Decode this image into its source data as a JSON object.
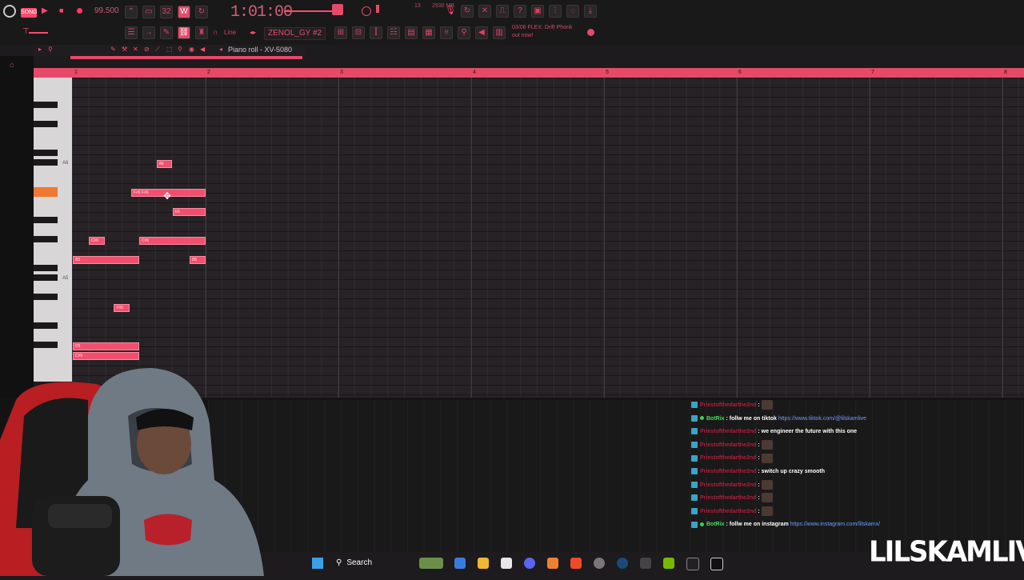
{
  "toolbar": {
    "song_label": "SONG",
    "tempo": "99.500",
    "time": "1:01:00",
    "cpu": "13",
    "memory": "2930 MB",
    "pattern": "ZENOL_GY #2",
    "snap": "Line",
    "hint_line1": "03/06 FLEX: Drift Phonk",
    "hint_line2": "out now!"
  },
  "piano_roll": {
    "title": "Piano roll - XV-5080",
    "bar_numbers": [
      "1",
      "2",
      "3",
      "4",
      "5",
      "6",
      "7",
      "8"
    ],
    "key_labels": [
      "A6",
      "A5"
    ],
    "notes": [
      {
        "label": "A6",
        "pitch": "A6",
        "start_bar": 1.63,
        "length_bars": 0.12
      },
      {
        "label": "F#6 F#6",
        "pitch": "F#6",
        "start_bar": 1.44,
        "length_bars": 0.56
      },
      {
        "label": "E6",
        "pitch": "E6",
        "start_bar": 1.75,
        "length_bars": 0.25
      },
      {
        "label": "C#6",
        "pitch": "C#6",
        "start_bar": 1.12,
        "length_bars": 0.12
      },
      {
        "label": "C#6",
        "pitch": "C#6",
        "start_bar": 1.5,
        "length_bars": 0.5
      },
      {
        "label": "B5",
        "pitch": "B5",
        "start_bar": 1.0,
        "length_bars": 0.5
      },
      {
        "label": "B5",
        "pitch": "B5",
        "start_bar": 1.88,
        "length_bars": 0.12
      },
      {
        "label": "F#5",
        "pitch": "F#5",
        "start_bar": 1.31,
        "length_bars": 0.12
      },
      {
        "label": "D5",
        "pitch": "D5",
        "start_bar": 1.0,
        "length_bars": 0.5
      },
      {
        "label": "C#5",
        "pitch": "C#5",
        "start_bar": 1.0,
        "length_bars": 0.5
      }
    ]
  },
  "chat": {
    "messages": [
      {
        "user": "Priestofthedarthe2nd",
        "text": ":",
        "emote": true,
        "bot": false
      },
      {
        "user": "BotRix",
        "text": ": follw me on tiktok",
        "link": "https://www.tiktok.com/@lilskamlive",
        "bot": true
      },
      {
        "user": "Priestofthedarthe2nd",
        "text": ": we engineer the future with this one",
        "bot": false
      },
      {
        "user": "Priestofthedarthe2nd",
        "text": ":",
        "emote": true,
        "bot": false
      },
      {
        "user": "Priestofthedarthe2nd",
        "text": ":",
        "emote": true,
        "bot": false
      },
      {
        "user": "Priestofthedarthe2nd",
        "text": ": switch up crazy smooth",
        "bot": false
      },
      {
        "user": "Priestofthedarthe2nd",
        "text": ":",
        "emote": true,
        "bot": false
      },
      {
        "user": "Priestofthedarthe2nd",
        "text": ":",
        "emote": true,
        "bot": false
      },
      {
        "user": "Priestofthedarthe2nd",
        "text": ":",
        "emote": true,
        "bot": false
      },
      {
        "user": "BotRix",
        "text": ": follw me on instagram",
        "link": "https://www.instagram.com/lilskamx/",
        "bot": true
      }
    ]
  },
  "taskbar": {
    "search_label": "Search"
  },
  "watermark": "LILSKAMLIVE",
  "colors": {
    "accent": "#e54a68",
    "note": "#f0506e",
    "key_highlight": "#f07830",
    "bot_name": "#4ed860"
  }
}
